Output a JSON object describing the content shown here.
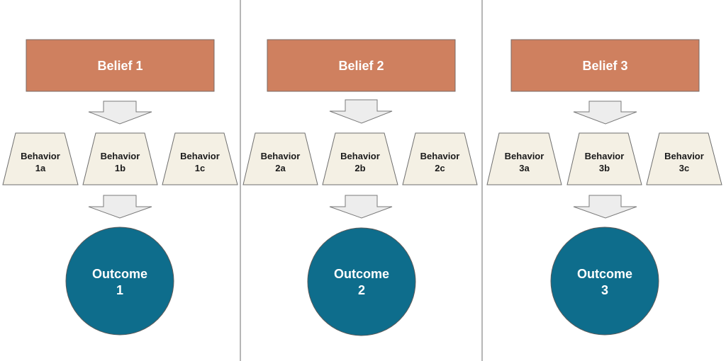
{
  "colors": {
    "belief_fill": "#CF805F",
    "belief_stroke": "#7a6a64",
    "behavior_fill": "#F4F0E4",
    "behavior_stroke": "#6e6e6e",
    "arrow_fill": "#EDEDED",
    "arrow_stroke": "#7a7a7a",
    "outcome_fill": "#0E6D8C",
    "outcome_stroke": "#5a5a5a",
    "divider": "#9e9e9e"
  },
  "columns": [
    {
      "belief": "Belief 1",
      "behaviors": [
        {
          "line1": "Behavior",
          "line2": "1a"
        },
        {
          "line1": "Behavior",
          "line2": "1b"
        },
        {
          "line1": "Behavior",
          "line2": "1c"
        }
      ],
      "outcome": {
        "line1": "Outcome",
        "line2": "1"
      }
    },
    {
      "belief": "Belief 2",
      "behaviors": [
        {
          "line1": "Behavior",
          "line2": "2a"
        },
        {
          "line1": "Behavior",
          "line2": "2b"
        },
        {
          "line1": "Behavior",
          "line2": "2c"
        }
      ],
      "outcome": {
        "line1": "Outcome",
        "line2": "2"
      }
    },
    {
      "belief": "Belief 3",
      "behaviors": [
        {
          "line1": "Behavior",
          "line2": "3a"
        },
        {
          "line1": "Behavior",
          "line2": "3b"
        },
        {
          "line1": "Behavior",
          "line2": "3c"
        }
      ],
      "outcome": {
        "line1": "Outcome",
        "line2": "3"
      }
    }
  ]
}
